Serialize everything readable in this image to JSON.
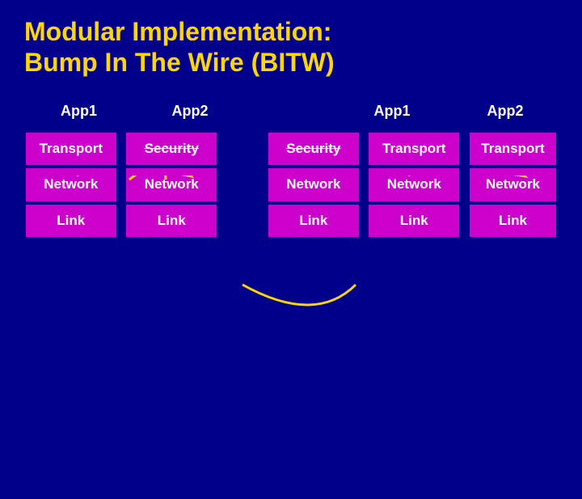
{
  "title": {
    "line1": "Modular Implementation:",
    "line2": "Bump In The Wire (BITW)"
  },
  "colors": {
    "background": "#00008B",
    "title": "#FFD700",
    "cell_magenta": "#CC00CC",
    "cell_dark_magenta": "#990099",
    "cell_navy": "#000066",
    "app_label": "#FFFFFF",
    "connector_stroke": "#FFD700"
  },
  "groups": [
    {
      "id": "group1",
      "app_label": "App1",
      "cells": [
        "Transport",
        "Network",
        "Link"
      ],
      "cell_types": [
        "magenta",
        "magenta",
        "magenta"
      ]
    },
    {
      "id": "group2",
      "app_label": "App2",
      "cells": [
        "Security",
        "Network",
        "Link"
      ],
      "cell_types": [
        "security",
        "magenta",
        "magenta"
      ]
    },
    {
      "id": "group3",
      "app_label": "",
      "cells": [
        "Security",
        "Network",
        "Link"
      ],
      "cell_types": [
        "security",
        "magenta",
        "magenta"
      ]
    },
    {
      "id": "group4",
      "app_label": "App1",
      "cells": [
        "Transport",
        "Network",
        "Link"
      ],
      "cell_types": [
        "magenta",
        "magenta",
        "magenta"
      ]
    },
    {
      "id": "group5",
      "app_label": "App2",
      "cells": [
        "Transport",
        "Network",
        "Link"
      ],
      "cell_types": [
        "magenta",
        "magenta",
        "magenta"
      ]
    }
  ]
}
